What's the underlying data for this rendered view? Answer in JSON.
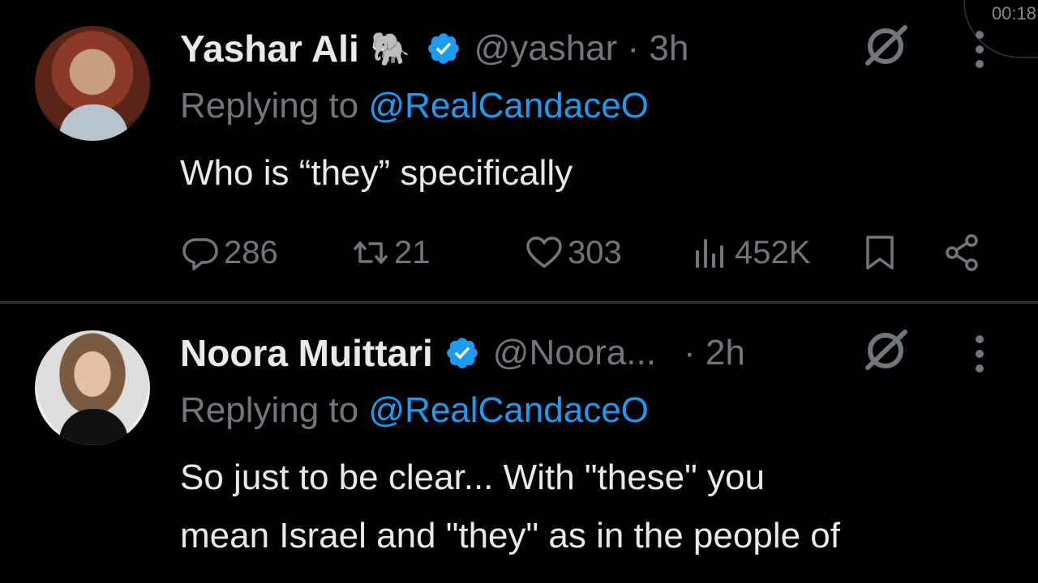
{
  "overlay": {
    "timer": "00:18"
  },
  "tweets": [
    {
      "name": "Yashar Ali",
      "emoji": "🐘",
      "handle_time": "@yashar · 3h",
      "replying_prefix": "Replying to",
      "replying_to": "@RealCandaceO",
      "text_lines": [
        "Who is “they” specifically"
      ],
      "counts": {
        "replies": "286",
        "reposts": "21",
        "likes": "303",
        "views": "452K"
      }
    },
    {
      "name": "Noora Muittari",
      "handle": "@Noora...",
      "time": "· 2h",
      "replying_prefix": "Replying to",
      "replying_to": "@RealCandaceO",
      "text_lines": [
        "So just to be clear... With \"these\" you",
        "mean Israel and \"they\" as in the people of"
      ]
    }
  ],
  "colors": {
    "accent": "#1d9bf0",
    "muted": "#71767b",
    "text": "#e7e9ea",
    "background": "#000000"
  }
}
